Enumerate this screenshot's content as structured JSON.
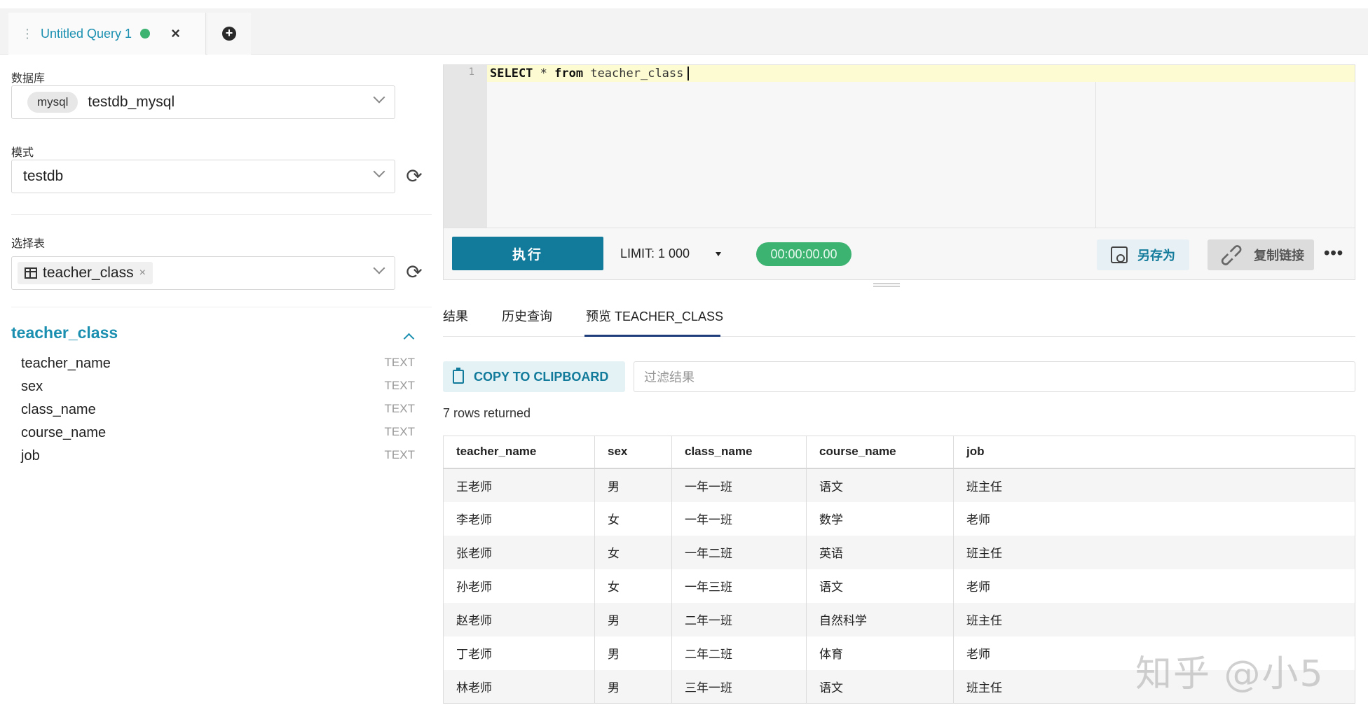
{
  "tab": {
    "title": "Untitled Query 1",
    "close": "×"
  },
  "left": {
    "database_label": "数据库",
    "database_engine": "mysql",
    "database_value": "testdb_mysql",
    "schema_label": "模式",
    "schema_value": "testdb",
    "table_label": "选择表",
    "table_chip": "teacher_class",
    "table_chip_x": "×",
    "tree_title": "teacher_class",
    "fields": [
      {
        "name": "teacher_name",
        "type": "TEXT"
      },
      {
        "name": "sex",
        "type": "TEXT"
      },
      {
        "name": "class_name",
        "type": "TEXT"
      },
      {
        "name": "course_name",
        "type": "TEXT"
      },
      {
        "name": "job",
        "type": "TEXT"
      }
    ]
  },
  "editor": {
    "line_number": "1",
    "kw_select": "SELECT",
    "star": " * ",
    "kw_from": "from",
    "table": " teacher_class"
  },
  "toolbar": {
    "run": "执行",
    "limit": "LIMIT:  1 000",
    "timer": "00:00:00.00",
    "save_as": "另存为",
    "copy_link": "复制链接",
    "more": "•••"
  },
  "results": {
    "tabs": [
      "结果",
      "历史查询",
      "预览 TEACHER_CLASS"
    ],
    "copy": "COPY TO CLIPBOARD",
    "filter_placeholder": "过滤结果",
    "rows_returned": "7 rows returned",
    "columns": [
      "teacher_name",
      "sex",
      "class_name",
      "course_name",
      "job"
    ],
    "rows": [
      [
        "王老师",
        "男",
        "一年一班",
        "语文",
        "班主任"
      ],
      [
        "李老师",
        "女",
        "一年一班",
        "数学",
        "老师"
      ],
      [
        "张老师",
        "女",
        "一年二班",
        "英语",
        "班主任"
      ],
      [
        "孙老师",
        "女",
        "一年三班",
        "语文",
        "老师"
      ],
      [
        "赵老师",
        "男",
        "二年一班",
        "自然科学",
        "班主任"
      ],
      [
        "丁老师",
        "男",
        "二年二班",
        "体育",
        "老师"
      ],
      [
        "林老师",
        "男",
        "三年一班",
        "语文",
        "班主任"
      ]
    ]
  },
  "watermark": "知乎 @小5",
  "colors": {
    "accent": "#127b9b",
    "status_green": "#3cb371",
    "link": "#1a8fb0"
  }
}
